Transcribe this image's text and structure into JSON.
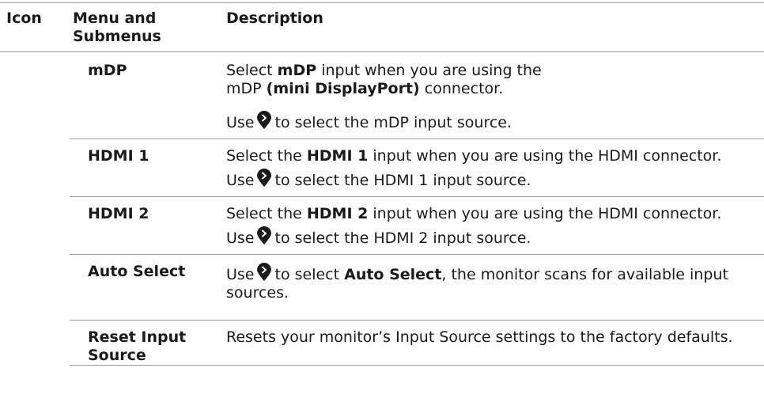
{
  "headers": {
    "icon": "Icon",
    "menu": "Menu and Submenus",
    "description": "Description"
  },
  "rows": [
    {
      "name": "mDP",
      "desc1_pre": "Select ",
      "desc1_bold": "mDP",
      "desc1_mid": " input when you are using the",
      "desc1_line2_pre": "mDP ",
      "desc1_line2_bold": "(mini DisplayPort)",
      "desc1_line2_post": " connector.",
      "use_pre": "Use",
      "use_post": "to select the mDP input source."
    },
    {
      "name": "HDMI 1",
      "desc1_pre": "Select the ",
      "desc1_bold": "HDMI 1",
      "desc1_post": " input when you are using the HDMI connector.",
      "use_pre": "Use",
      "use_post": "to select the HDMI 1 input source."
    },
    {
      "name": "HDMI 2",
      "desc1_pre": "Select the ",
      "desc1_bold": "HDMI 2",
      "desc1_post": " input when you are using the HDMI connector.",
      "use_pre": "Use",
      "use_post": "to select the HDMI 2 input source."
    },
    {
      "name": "Auto Select",
      "use_pre": "Use",
      "use_mid": "to select ",
      "use_bold": "Auto Select",
      "use_post": ", the monitor scans for available input sources."
    },
    {
      "name": "Reset Input Source",
      "desc1": "Resets your monitor’s Input Source settings to the factory defaults."
    }
  ],
  "icons": {
    "select_button": "select-button-icon"
  },
  "colors": {
    "text": "#1a1a1a",
    "rule": "#9a9a9a"
  }
}
